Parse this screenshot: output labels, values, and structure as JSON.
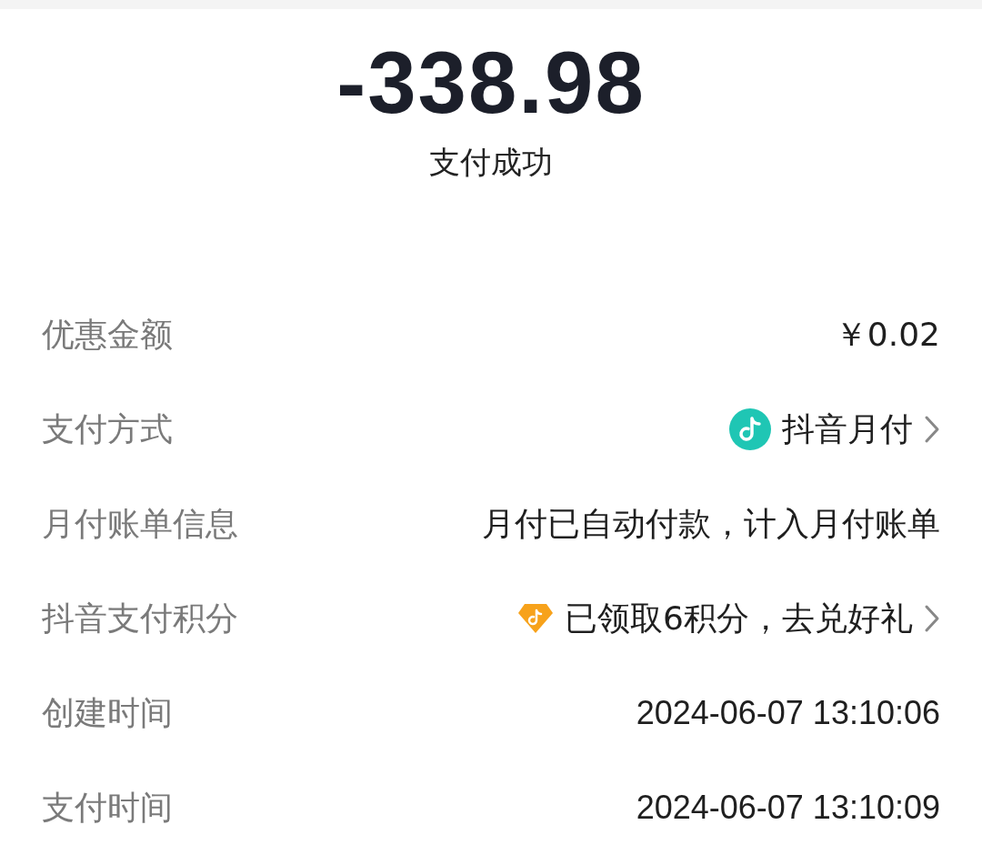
{
  "amount": "-338.98",
  "status": "支付成功",
  "rows": [
    {
      "kind": "plain",
      "label": "优惠金额",
      "value": "￥0.02"
    },
    {
      "kind": "pay_method",
      "label": "支付方式",
      "value": "抖音月付"
    },
    {
      "kind": "plain",
      "label": "月付账单信息",
      "value": "月付已自动付款，计入月付账单"
    },
    {
      "kind": "points",
      "label": "抖音支付积分",
      "value": "已领取6积分，去兑好礼"
    },
    {
      "kind": "plain",
      "label": "创建时间",
      "value": "2024-06-07 13:10:06"
    },
    {
      "kind": "plain",
      "label": "支付时间",
      "value": "2024-06-07 13:10:09"
    }
  ]
}
